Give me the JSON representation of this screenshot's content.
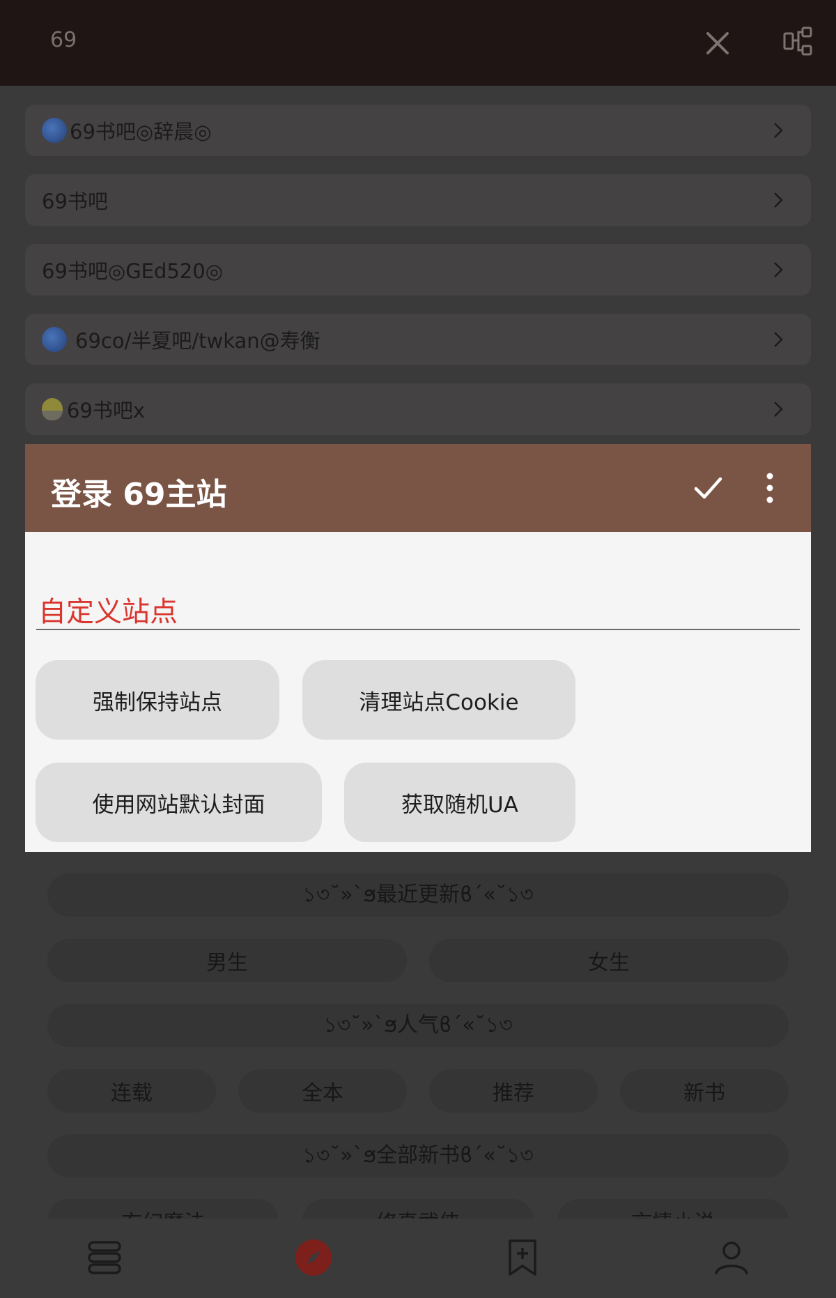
{
  "topbar": {
    "search_value": "69"
  },
  "source_list": [
    {
      "label": "69书吧◎辞晨◎",
      "icon": "globe-icon"
    },
    {
      "label": "69书吧",
      "icon": ""
    },
    {
      "label": "69书吧◎GEd520◎",
      "icon": ""
    },
    {
      "label": "69co/半夏吧/twkan@寿衡",
      "icon": "globe-icon"
    },
    {
      "label": "69书吧x",
      "icon": "chick-icon"
    }
  ],
  "dialog": {
    "title": "登录 69主站",
    "field_label": "自定义站点",
    "buttons": [
      "强制保持站点",
      "清理站点Cookie",
      "使用网站默认封面",
      "获取随机UA"
    ]
  },
  "explore": {
    "recent": "১৩˘»`ϧ最近更新ϐ´«˘১৩",
    "male": "男生",
    "female": "女生",
    "popular": "১৩˘»`ϧ人气ϐ´«˘১৩",
    "tabs": [
      "连载",
      "全本",
      "推荐",
      "新书"
    ],
    "all_new": "১৩˘»`ϧ全部新书ϐ´«˘১৩",
    "genres": [
      "玄幻魔法",
      "修真武侠",
      "言情小说"
    ]
  },
  "bottom_nav": [
    "bookshelf-icon",
    "explore-compass-icon",
    "subscription-icon",
    "profile-icon"
  ],
  "colors": {
    "header": "#7a5546",
    "accent": "#d8362e",
    "topbar": "#1e1514"
  }
}
